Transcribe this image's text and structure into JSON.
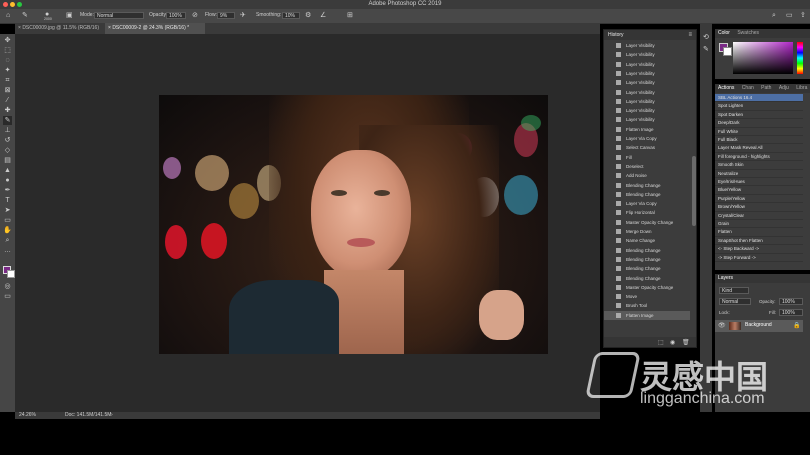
{
  "window": {
    "title": "Adobe Photoshop CC 2019"
  },
  "options": {
    "mode_label": "Mode:",
    "mode_value": "Normal",
    "opacity_label": "Opacity:",
    "opacity_value": "100%",
    "flow_label": "Flow:",
    "flow_value": "9%",
    "smoothing_label": "Smoothing:",
    "smoothing_value": "10%",
    "brush_size": "2000"
  },
  "tabs": [
    {
      "label": "DSC00009.jpg @ 11.5% (RGB/16)"
    },
    {
      "label": "DSC00009-2 @ 24.3% (RGB/16) *"
    }
  ],
  "status": {
    "zoom": "24.26%",
    "doc": "Doc: 141.5M/141.5M"
  },
  "history": {
    "title": "History",
    "items": [
      "Layer Visibility",
      "Layer Visibility",
      "Layer Visibility",
      "Layer Visibility",
      "Layer Visibility",
      "Layer Visibility",
      "Layer Visibility",
      "Layer Visibility",
      "Layer Visibility",
      "Flatten Image",
      "Layer Via Copy",
      "Select Canvas",
      "Fill",
      "Deselect",
      "Add Noise",
      "Blending Change",
      "Blending Change",
      "Layer Via Copy",
      "Flip Horizontal",
      "Master Opacity Change",
      "Merge Down",
      "Name Change",
      "Blending Change",
      "Blending Change",
      "Blending Change",
      "Blending Change",
      "Master Opacity Change",
      "Move",
      "Brush Tool",
      "Flatten Image"
    ],
    "selected_index": 29
  },
  "color_panel": {
    "tabs": [
      "Color",
      "Swatches"
    ],
    "fg": "#7a2a86",
    "bg": "#ffffff"
  },
  "actions_panel": {
    "tabs": [
      "Actions",
      "Chan",
      "Path",
      "Adju",
      "Libra"
    ],
    "items": [
      "SBL Actions 16.4",
      "Spot Lighten",
      "Spot Darken",
      "Deep/Dark",
      "Full White",
      "Full Black",
      "Layer Mask Reveal All",
      "Fill foreground - highlights",
      "Smooth Skin",
      "Neutralize",
      "Eye/Iris/Hues",
      "Blue/Yellow",
      "Purple/Yellow",
      "Brown/Yellow",
      "Crystal/Clear",
      "Grain",
      "Flatten",
      "SnapShot then Flatten",
      "<- Step Backward ->",
      "-> Step Forward ->"
    ],
    "selected_index": 0
  },
  "layers_panel": {
    "title": "Layers",
    "kind_label": "Kind",
    "blend": "Normal",
    "opacity_label": "Opacity:",
    "opacity_value": "100%",
    "lock_label": "Lock:",
    "fill_label": "Fill:",
    "fill_value": "100%",
    "layers": [
      {
        "name": "Background",
        "locked": true
      }
    ]
  },
  "watermark": {
    "brand": "灵感中国",
    "url": "lingganchina.com",
    "suffix": ".com"
  }
}
